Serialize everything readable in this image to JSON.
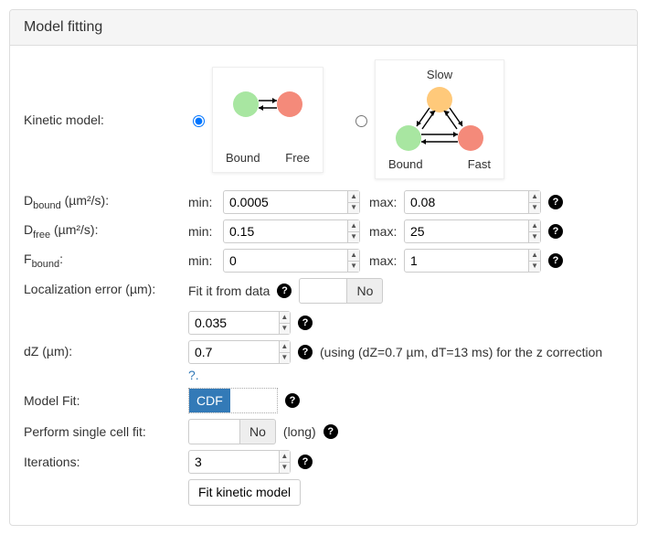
{
  "panel": {
    "title": "Model fitting"
  },
  "labels": {
    "kinetic_model": "Kinetic model:",
    "d_bound_html": "D<sub>bound</sub> (µm²/s):",
    "d_free_html": "D<sub>free</sub> (µm²/s):",
    "f_bound_html": "F<sub>bound</sub>:",
    "loc_error": "Localization error (µm):",
    "dz": "dZ (µm):",
    "model_fit": "Model Fit:",
    "single_cell": "Perform single cell fit:",
    "iterations": "Iterations:"
  },
  "common": {
    "min": "min:",
    "max": "max:"
  },
  "kinetic_models": {
    "selected": "two_state",
    "two_state": {
      "bound": "Bound",
      "free": "Free"
    },
    "three_state": {
      "slow": "Slow",
      "bound": "Bound",
      "fast": "Fast"
    }
  },
  "d_bound": {
    "min": "0.0005",
    "max": "0.08"
  },
  "d_free": {
    "min": "0.15",
    "max": "25"
  },
  "f_bound": {
    "min": "0",
    "max": "1"
  },
  "loc_error": {
    "fit_label": "Fit it from data",
    "toggle": "No",
    "value": "0.035"
  },
  "dz": {
    "value": "0.7",
    "note": "(using (dZ=0.7 µm, dT=13 ms) for the z correction",
    "question": "?."
  },
  "model_fit": {
    "selected": "CDF"
  },
  "single_cell": {
    "toggle": "No",
    "suffix": "(long)"
  },
  "iterations": {
    "value": "3"
  },
  "actions": {
    "fit_button": "Fit kinetic model"
  }
}
